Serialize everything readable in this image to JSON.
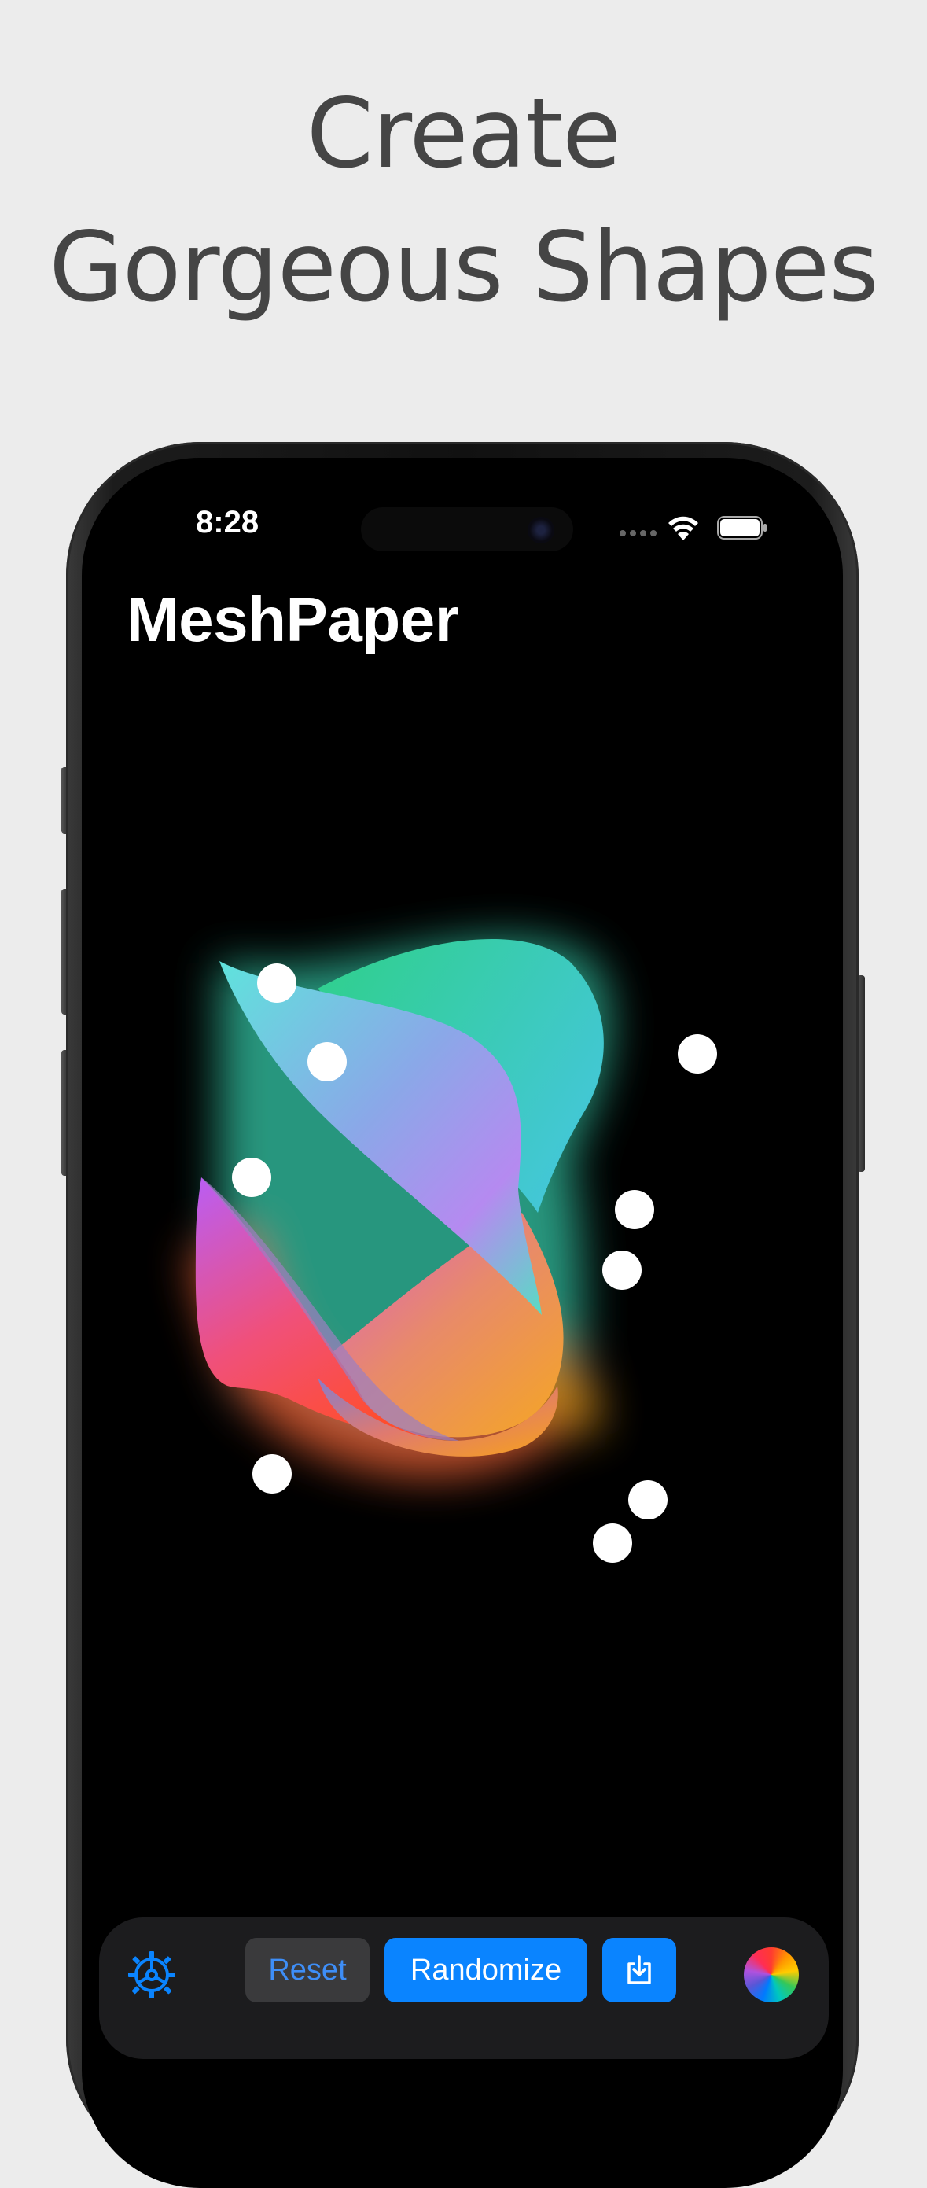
{
  "headline": {
    "line1": "Create",
    "line2": "Gorgeous Shapes"
  },
  "status_bar": {
    "time": "8:28"
  },
  "app": {
    "title": "MeshPaper"
  },
  "toolbar": {
    "reset_label": "Reset",
    "randomize_label": "Randomize",
    "export_icon": "download-tray-icon",
    "settings_icon": "gear-icon",
    "color_icon": "color-wheel-icon"
  },
  "colors": {
    "accent": "#0a84ff",
    "toolbar_bg": "#1c1c1e",
    "reset_bg": "#3a3a3c"
  }
}
